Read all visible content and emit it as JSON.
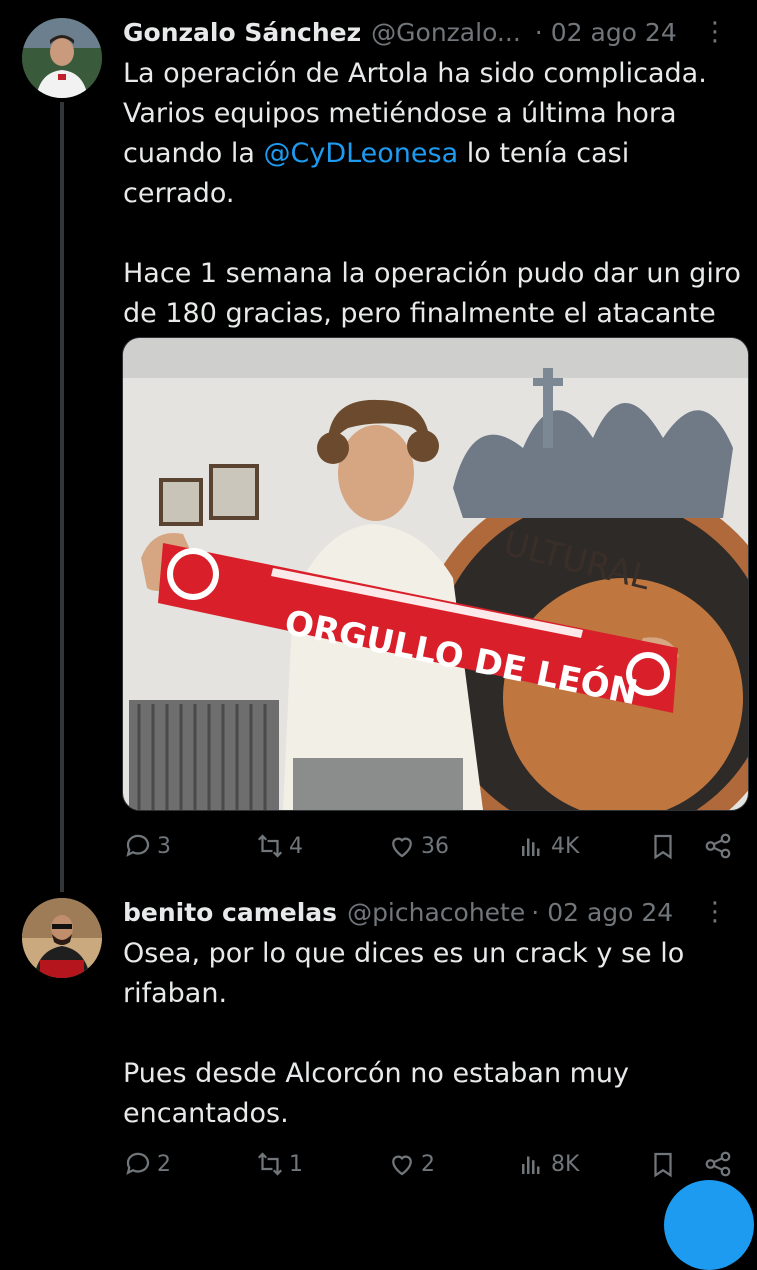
{
  "tweet1": {
    "name": "Gonzalo Sánchez",
    "handle": "@Gonzalo...",
    "separator": "·",
    "date": "02 ago 24",
    "more": "⋮",
    "text_before_mention": "La operación de Artola ha sido complicada.\nVarios equipos metiéndose a última hora\ncuando la ",
    "mention": "@CyDLeonesa",
    "text_after_mention": " lo tenía casi cerrado.\n\nHace 1 semana la operación pudo dar un giro\nde 180 gracias, pero finalmente el atacante se\ndecantó por el proyecto leonés.",
    "image": {
      "scarf_text": "ORGULLO DE LEÓN",
      "wall_text": "ULTURAL"
    },
    "replies": "3",
    "reposts": "4",
    "likes": "36",
    "views": "4K"
  },
  "tweet2": {
    "name": "benito camelas",
    "handle": "@pichacohete",
    "separator": "·",
    "date": "02 ago 24",
    "more": "⋮",
    "text": "Osea, por lo que dices es un crack y se lo\nrifaban.\n\nPues desde Alcorcón no estaban muy\nencantados.",
    "replies": "2",
    "reposts": "1",
    "likes": "2",
    "views": "8K"
  },
  "colors": {
    "background": "#000000",
    "text": "#e7e9ea",
    "muted": "#71767b",
    "accent": "#1d9bf0",
    "scarf_red": "#d9202a"
  }
}
